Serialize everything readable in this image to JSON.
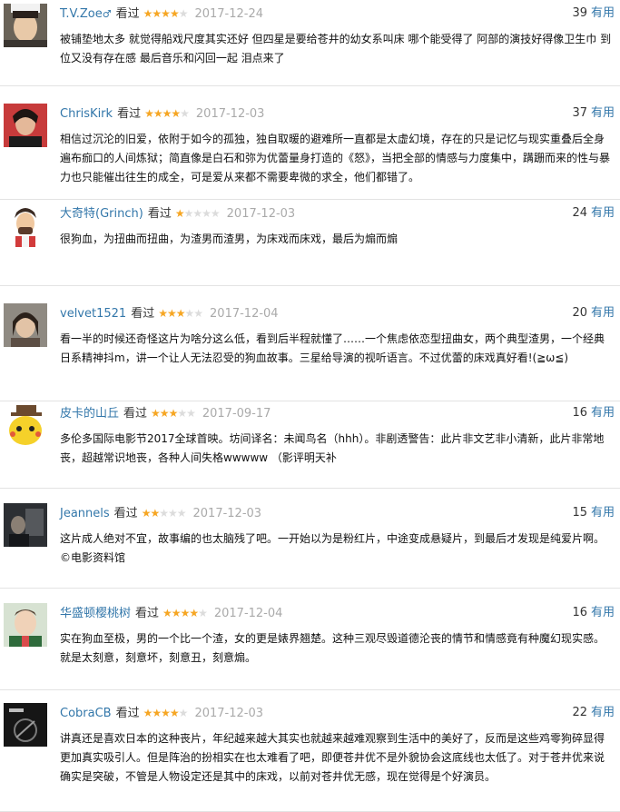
{
  "reviews": [
    {
      "username": "T.V.Zoe",
      "badge": "♂",
      "seen_label": "看过",
      "rating": 4,
      "date": "2017-12-24",
      "votes": "39",
      "useful_label": "有用",
      "text": "被铺垫地太多 就觉得船戏尺度其实还好 但四星是要给苍井的幼女系叫床 哪个能受得了 阿部的演技好得像卫生巾 到位又没有存在感 最后音乐和闪回一起 泪点来了",
      "avatar": "avatar-person-1"
    },
    {
      "username": "ChrisKirk",
      "badge": "",
      "seen_label": "看过",
      "rating": 4,
      "date": "2017-12-03",
      "votes": "37",
      "useful_label": "有用",
      "text": "相信过沉沦的旧爱，依附于如今的孤独，独自取暖的避难所一直都是太虚幻境，存在的只是记忆与现实重叠后全身遍布痂口的人间炼狱；简直像是白石和弥为优蕾量身打造的《怒》，当把全部的情感与力度集中，蹒跚而来的性与暴力也只能催出往生的成全，可是爱从来都不需要卑微的求全，他们都错了。",
      "avatar": "avatar-person-2"
    },
    {
      "username": "大奇特(Grinch)",
      "badge": "",
      "seen_label": "看过",
      "rating": 1,
      "date": "2017-12-03",
      "votes": "24",
      "useful_label": "有用",
      "text": "很狗血，为扭曲而扭曲，为渣男而渣男，为床戏而床戏，最后为煽而煽",
      "avatar": "avatar-cartoon-man"
    },
    {
      "username": "velvet1521",
      "badge": "",
      "seen_label": "看过",
      "rating": 3,
      "date": "2017-12-04",
      "votes": "20",
      "useful_label": "有用",
      "text": "看一半的时候还奇怪这片为啥分这么低，看到后半程就懂了……一个焦虑依恋型扭曲女，两个典型渣男，一个经典日系精神抖m，讲一个让人无法忍受的狗血故事。三星给导演的视听语言。不过优蕾的床戏真好看!(≧ω≦)",
      "avatar": "avatar-person-3"
    },
    {
      "username": "皮卡的山丘",
      "badge": "",
      "seen_label": "看过",
      "rating": 3,
      "date": "2017-09-17",
      "votes": "16",
      "useful_label": "有用",
      "text": "多伦多国际电影节2017全球首映。坊间译名：未闻鸟名（hhh）。非剧透警告：此片非文艺非小清新，此片非常地丧，超越常识地丧，各种人间失格wwwww （影评明天补",
      "avatar": "avatar-pikachu"
    },
    {
      "username": "Jeannels",
      "badge": "",
      "seen_label": "看过",
      "rating": 2,
      "date": "2017-12-03",
      "votes": "15",
      "useful_label": "有用",
      "text": "这片成人绝对不宜，故事编的也太脑残了吧。一开始以为是粉红片，中途变成悬疑片，到最后才发现是纯爱片啊。©电影资料馆",
      "avatar": "avatar-dark-scene"
    },
    {
      "username": "华盛顿樱桃树",
      "badge": "",
      "seen_label": "看过",
      "rating": 4,
      "date": "2017-12-04",
      "votes": "16",
      "useful_label": "有用",
      "text": "实在狗血至极，男的一个比一个渣，女的更是婊界翘楚。这种三观尽毁道德沦丧的情节和情感竟有种魔幻现实感。就是太刻意，刻意坏，刻意丑，刻意煽。",
      "avatar": "avatar-person-4"
    },
    {
      "username": "CobraCB",
      "badge": "",
      "seen_label": "看过",
      "rating": 4,
      "date": "2017-12-03",
      "votes": "22",
      "useful_label": "有用",
      "text": "讲真还是喜欢日本的这种丧片，年纪越来越大其实也就越来越难观察到生活中的美好了，反而是这些鸡零狗碎显得更加真实吸引人。但是阵治的扮相实在也太难看了吧，即便苍井优不是外貌协会这底线也太低了。对于苍井优来说确实是突破，不管是人物设定还是其中的床戏，以前对苍井优无感，现在觉得是个好演员。",
      "avatar": "avatar-dark-art"
    }
  ]
}
